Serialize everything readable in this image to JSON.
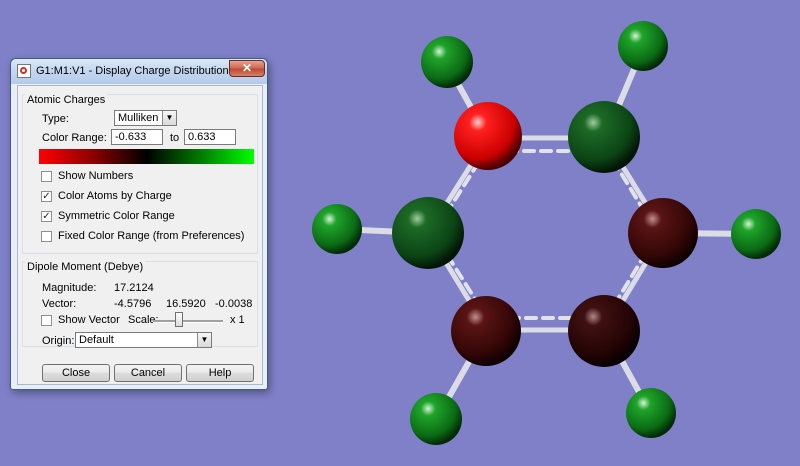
{
  "dialog": {
    "title": "G1:M1:V1 - Display Charge Distribution",
    "close_glyph": "✕",
    "atomic_charges": {
      "group_title": "Atomic Charges",
      "type_label": "Type:",
      "type_value": "Mulliken",
      "color_range_label": "Color Range:",
      "range_min": "-0.633",
      "range_to": "to",
      "range_max": "0.633",
      "color_gradient": [
        "#ff0000",
        "#8c0000",
        "#000000",
        "#007a00",
        "#00ff00"
      ],
      "checkboxes": [
        {
          "label": "Show Numbers",
          "checked": false
        },
        {
          "label": "Color Atoms by Charge",
          "checked": true
        },
        {
          "label": "Symmetric Color Range",
          "checked": true
        },
        {
          "label": "Fixed Color Range (from Preferences)",
          "checked": false
        }
      ]
    },
    "dipole": {
      "group_title": "Dipole Moment (Debye)",
      "magnitude_label": "Magnitude:",
      "magnitude_value": "17.2124",
      "vector_label": "Vector:",
      "vector_x": "-4.5796",
      "vector_y": "16.5920",
      "vector_z": "-0.0038",
      "show_vector_label": "Show Vector",
      "show_vector_checked": false,
      "scale_label": "Scale:",
      "scale_value": "x 1"
    },
    "origin_label": "Origin:",
    "origin_value": "Default",
    "buttons": {
      "close": "Close",
      "cancel": "Cancel",
      "help": "Help"
    }
  },
  "molecule": {
    "background": "#7f80c8",
    "atoms": [
      {
        "name": "ring-atom-top-left",
        "color": "#ff0000"
      },
      {
        "name": "ring-atom-top-right",
        "color": "#0b4a15"
      },
      {
        "name": "ring-atom-right",
        "color": "#3b0707"
      },
      {
        "name": "ring-atom-bottom-right",
        "color": "#2a0606"
      },
      {
        "name": "ring-atom-bottom-left",
        "color": "#3d0b0b"
      },
      {
        "name": "ring-atom-left",
        "color": "#0e4d16"
      },
      {
        "name": "hydrogen-atom",
        "color": "#0e7a18"
      }
    ]
  }
}
